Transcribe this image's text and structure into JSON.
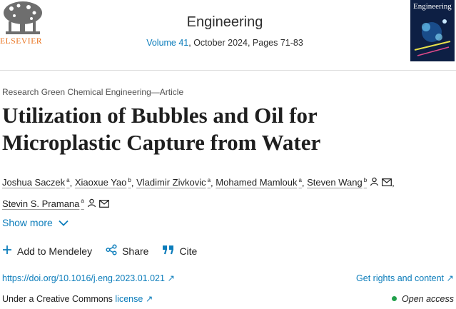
{
  "header": {
    "publisher": "ELSEVIER",
    "journal_name": "Engineering",
    "volume_link": "Volume 41",
    "volume_rest": ", October 2024, Pages 71-83",
    "cover_title": "Engineering",
    "colors": {
      "publisher_orange": "#e9711c",
      "link_blue": "#0c7dbb",
      "cover_bg": "#0d1f44"
    }
  },
  "article": {
    "type": "Research Green Chemical Engineering—Article",
    "title_line1": "Utilization of Bubbles and Oil for",
    "title_line2": "Microplastic Capture from Water"
  },
  "authors": [
    {
      "name": "Joshua Saczek",
      "sup": "a",
      "icons": []
    },
    {
      "name": "Xiaoxue Yao",
      "sup": "b",
      "icons": []
    },
    {
      "name": "Vladimir Zivkovic",
      "sup": "a",
      "icons": []
    },
    {
      "name": "Mohamed Mamlouk",
      "sup": "a",
      "icons": []
    },
    {
      "name": "Steven Wang",
      "sup": "b",
      "icons": [
        "person-icon",
        "envelope-icon"
      ]
    },
    {
      "name": "Stevin S. Pramana",
      "sup": "a",
      "icons": [
        "person-icon",
        "envelope-icon"
      ]
    }
  ],
  "show_more": "Show more",
  "actions": {
    "mendeley": "Add to Mendeley",
    "share": "Share",
    "cite": "Cite"
  },
  "links": {
    "doi": "https://doi.org/10.1016/j.eng.2023.01.021",
    "rights": "Get rights and content",
    "license_prefix": "Under a Creative Commons ",
    "license_link": "license",
    "open_access": "Open access"
  }
}
